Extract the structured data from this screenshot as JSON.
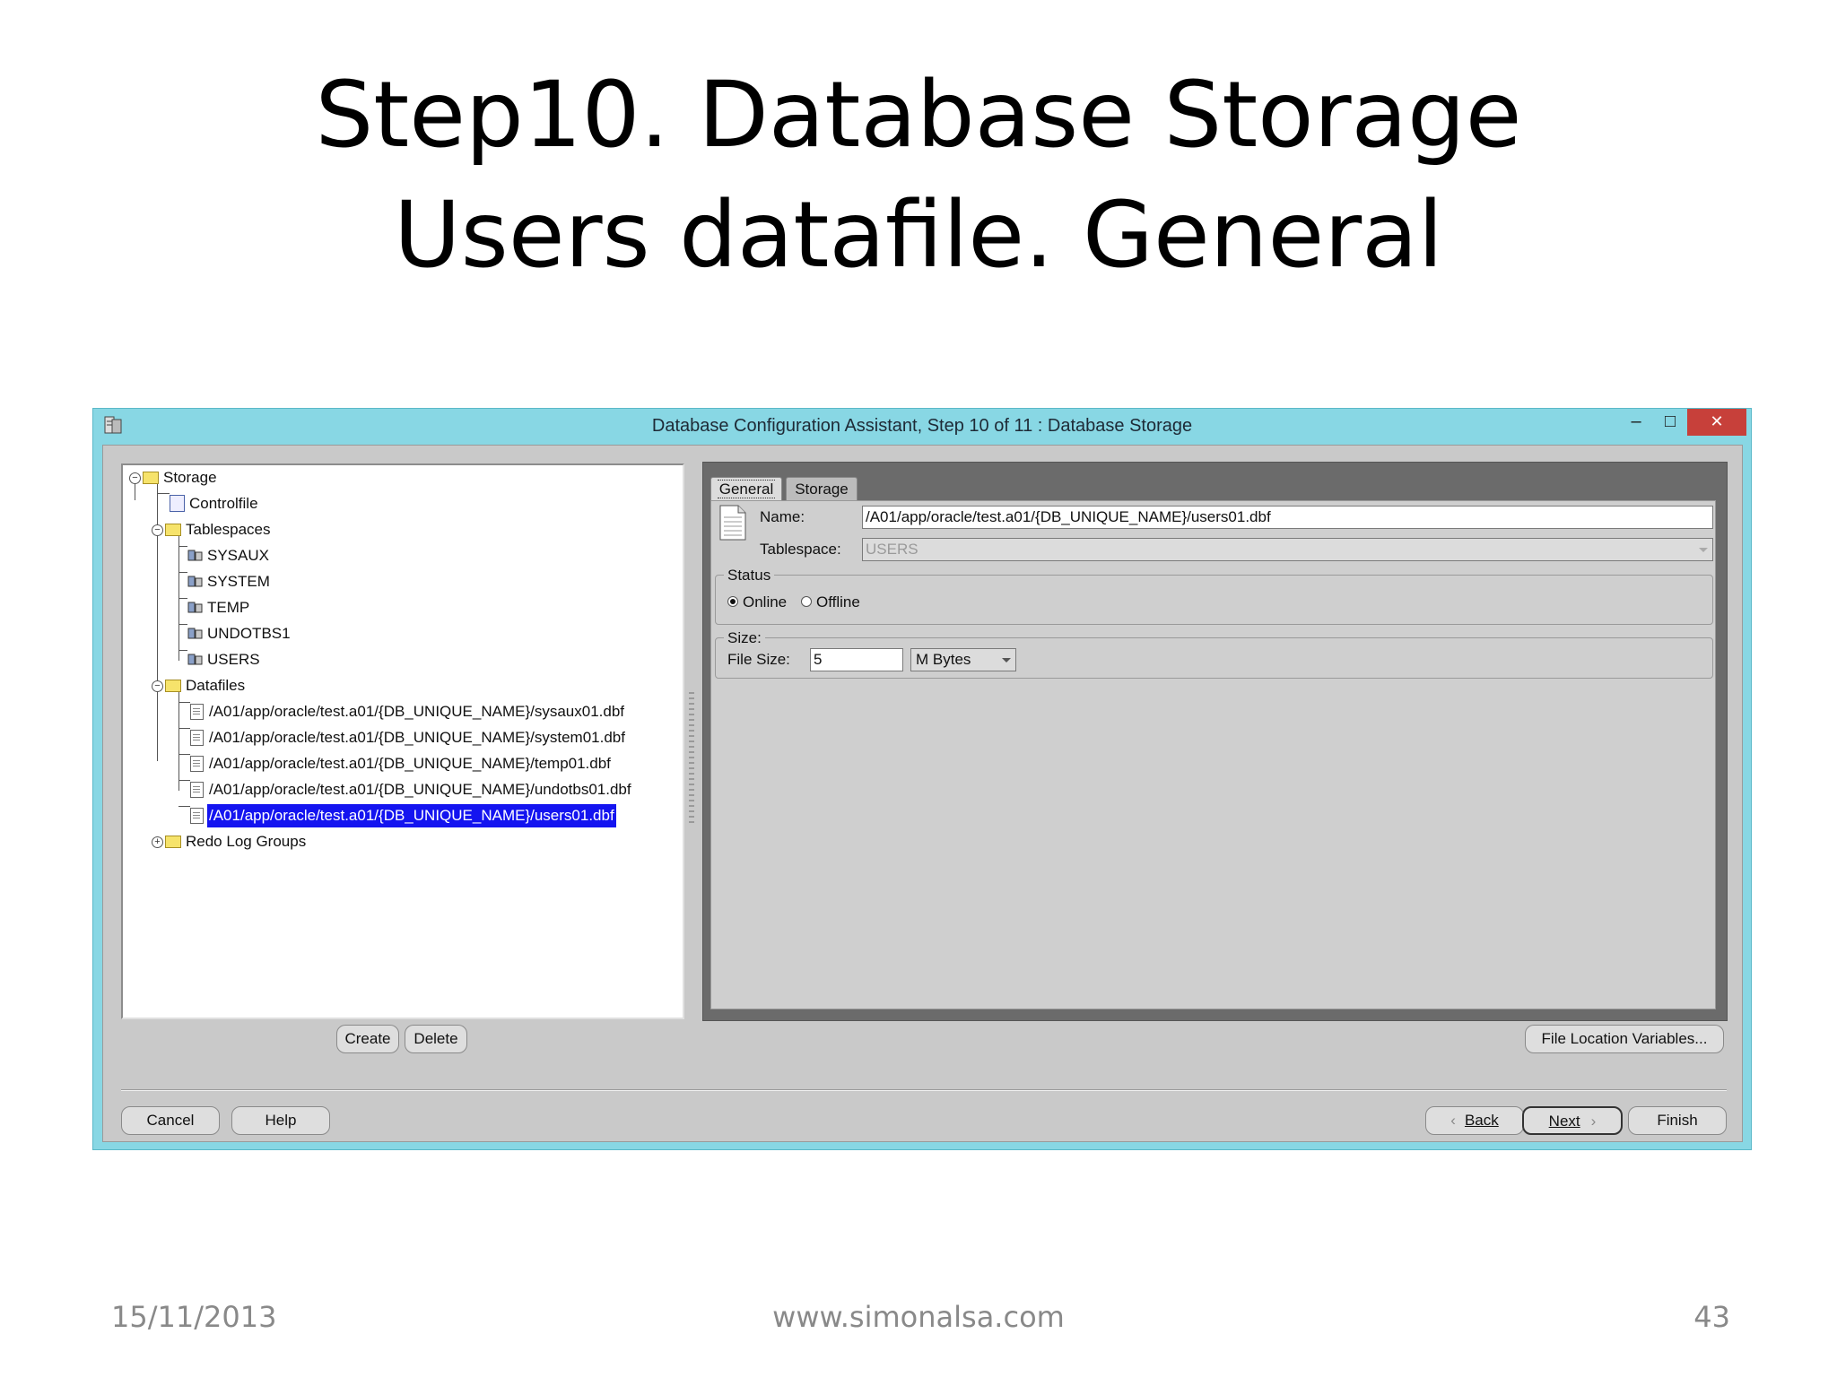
{
  "slide": {
    "title_line1": "Step10. Database Storage",
    "title_line2": "Users datafile. General",
    "date": "15/11/2013",
    "website": "www.simonalsa.com",
    "page_number": "43"
  },
  "window": {
    "title": "Database Configuration Assistant, Step 10 of 11 : Database Storage",
    "minimize_glyph": "–",
    "maximize_glyph": "□",
    "close_glyph": "✕"
  },
  "tree": {
    "storage": "Storage",
    "controlfile": "Controlfile",
    "tablespaces": "Tablespaces",
    "tablespace_items": [
      "SYSAUX",
      "SYSTEM",
      "TEMP",
      "UNDOTBS1",
      "USERS"
    ],
    "datafiles": "Datafiles",
    "datafile_items": [
      "/A01/app/oracle/test.a01/{DB_UNIQUE_NAME}/sysaux01.dbf",
      "/A01/app/oracle/test.a01/{DB_UNIQUE_NAME}/system01.dbf",
      "/A01/app/oracle/test.a01/{DB_UNIQUE_NAME}/temp01.dbf",
      "/A01/app/oracle/test.a01/{DB_UNIQUE_NAME}/undotbs01.dbf",
      "/A01/app/oracle/test.a01/{DB_UNIQUE_NAME}/users01.dbf"
    ],
    "selected_datafile": "/A01/app/oracle/test.a01/{DB_UNIQUE_NAME}/users01.dbf",
    "redo_log_groups": "Redo Log Groups"
  },
  "tabs": {
    "general": "General",
    "storage": "Storage",
    "active": "General"
  },
  "general": {
    "name_label": "Name:",
    "name_value": "/A01/app/oracle/test.a01/{DB_UNIQUE_NAME}/users01.dbf",
    "tablespace_label": "Tablespace:",
    "tablespace_value": "USERS",
    "status_title": "Status",
    "online_label": "Online",
    "offline_label": "Offline",
    "status_selected": "Online",
    "size_title": "Size:",
    "file_size_label": "File Size:",
    "file_size_value": "5",
    "unit_value": "M Bytes"
  },
  "buttons": {
    "create": "Create",
    "delete": "Delete",
    "file_location_variables": "File Location Variables...",
    "cancel": "Cancel",
    "help": "Help",
    "back": "Back",
    "next": "Next",
    "finish": "Finish"
  }
}
